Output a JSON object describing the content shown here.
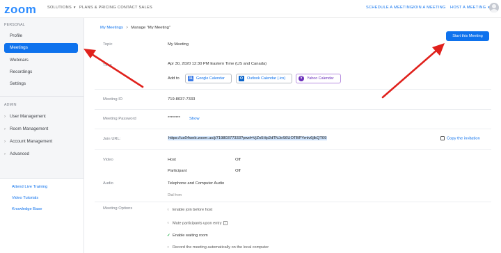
{
  "topnav": {
    "logo": "zoom",
    "solutions": "SOLUTIONS",
    "plans": "PLANS & PRICING",
    "contact": "CONTACT SALES",
    "schedule": "SCHEDULE A MEETING",
    "join": "JOIN A MEETING",
    "host": "HOST A MEETING",
    "caret_icon": "chevron-down-icon"
  },
  "sidebar": {
    "personal_label": "PERSONAL",
    "items": [
      "Profile",
      "Meetings",
      "Webinars",
      "Recordings",
      "Settings"
    ],
    "active_item": "Meetings",
    "admin_label": "ADMIN",
    "admin_items": [
      "User Management",
      "Room Management",
      "Account Management",
      "Advanced"
    ],
    "links": [
      "Attend Live Training",
      "Video Tutorials",
      "Knowledge Base"
    ]
  },
  "breadcrumb": {
    "link": "My Meetings",
    "sep": ">",
    "current": "Manage \"My Meeting\""
  },
  "start_button": "Start this Meeting",
  "details": {
    "topic_label": "Topic",
    "topic_value": "My Meeting",
    "time_label": "Time",
    "time_value": "Apr 30, 2020 12:30 PM Eastern Time (US and Canada)",
    "add_to": "Add to",
    "calendars": [
      "Google Calendar",
      "Outlook Calendar (.ics)",
      "Yahoo Calendar"
    ],
    "meeting_id_label": "Meeting ID",
    "meeting_id_value": "719-8037-7333",
    "password_label": "Meeting Password",
    "password_value": "********",
    "show_link": "Show",
    "join_label": "Join URL:",
    "join_url": "https://us04web.zoom.us/j/71980377333?pwd=VjZn5Hp2dTNJeS6UOTBPYmlv6jlkQT09",
    "copy_link": "Copy the invitation",
    "video_label": "Video",
    "host_label": "Host",
    "host_value": "Off",
    "participant_label": "Participant",
    "participant_value": "Off",
    "audio_label": "Audio",
    "audio_value": "Telephone and Computer Audio",
    "dial_from": "Dial from",
    "options_label": "Meeting Options",
    "options": [
      {
        "text": "Enable join before host",
        "checked": false
      },
      {
        "text": "Mute participants upon entry",
        "checked": false
      },
      {
        "text": "Enable waiting room",
        "checked": true
      },
      {
        "text": "Record the meeting automatically on the local computer",
        "checked": false
      }
    ]
  },
  "colors": {
    "brand_blue": "#0e72ed",
    "arrow_red": "#e0211c",
    "check_green": "#23b04c"
  }
}
